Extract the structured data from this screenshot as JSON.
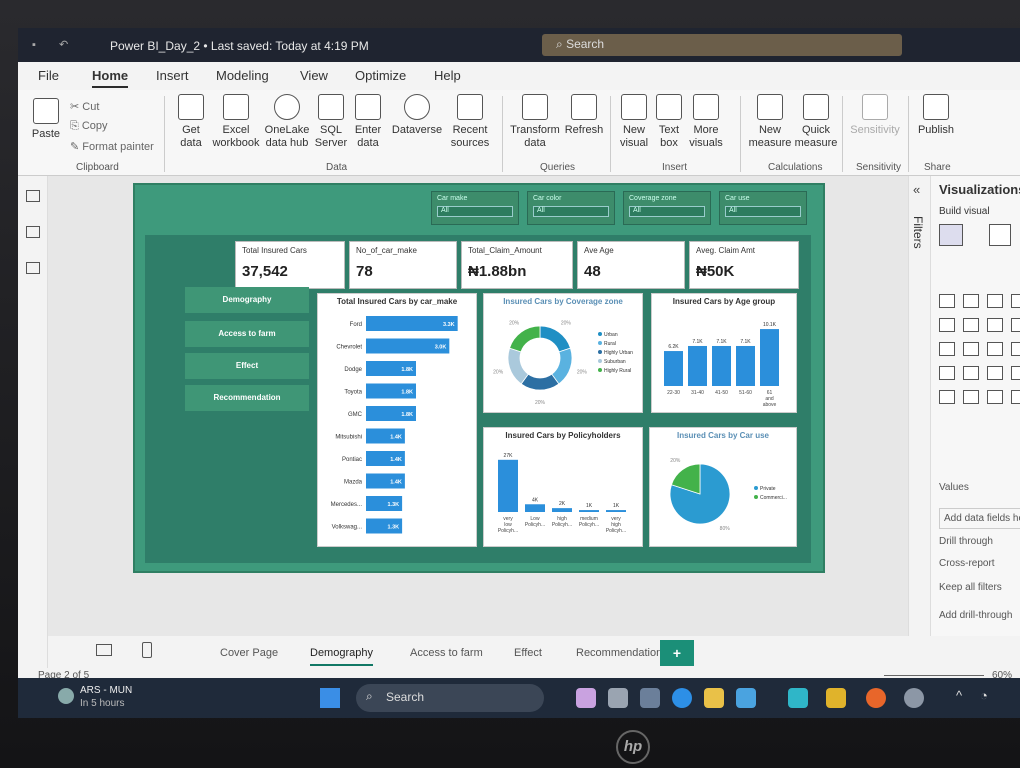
{
  "window": {
    "title": "Power BI_Day_2 • Last saved: Today at 4:19 PM",
    "search_placeholder": "Search"
  },
  "menu": [
    "File",
    "Home",
    "Insert",
    "Modeling",
    "View",
    "Optimize",
    "Help"
  ],
  "ribbon": {
    "clipboard": {
      "paste": "Paste",
      "cut": "Cut",
      "copy": "Copy",
      "format_painter": "Format painter",
      "group": "Clipboard"
    },
    "data": {
      "get_data": "Get\ndata",
      "excel": "Excel\nworkbook",
      "onelake": "OneLake\ndata hub",
      "sql": "SQL\nServer",
      "enter": "Enter\ndata",
      "dataverse": "Dataverse",
      "recent": "Recent\nsources",
      "group": "Data"
    },
    "queries": {
      "transform": "Transform\ndata",
      "refresh": "Refresh",
      "group": "Queries"
    },
    "insert": {
      "new_visual": "New\nvisual",
      "text_box": "Text\nbox",
      "more_visuals": "More\nvisuals",
      "group": "Insert"
    },
    "calculations": {
      "new_measure": "New\nmeasure",
      "quick_measure": "Quick\nmeasure",
      "group": "Calculations"
    },
    "sensitivity": {
      "label": "Sensitivity",
      "group": "Sensitivity"
    },
    "share": {
      "publish": "Publish",
      "group": "Share"
    }
  },
  "slicers": [
    {
      "label": "Car make",
      "value": "All"
    },
    {
      "label": "Car color",
      "value": "All"
    },
    {
      "label": "Coverage zone",
      "value": "All"
    },
    {
      "label": "Car use",
      "value": "All"
    }
  ],
  "kpis": [
    {
      "label": "Total Insured Cars",
      "value": "37,542"
    },
    {
      "label": "No_of_car_make",
      "value": "78"
    },
    {
      "label": "Total_Claim_Amount",
      "value": "₦1.88bn"
    },
    {
      "label": "Ave Age",
      "value": "48"
    },
    {
      "label": "Aveg. Claim Amt",
      "value": "₦50K"
    }
  ],
  "nav_buttons": [
    "Demography",
    "Access to farm",
    "Effect",
    "Recommendation"
  ],
  "charts": {
    "make": {
      "title": "Total Insured Cars by car_make",
      "chart_data": {
        "type": "bar",
        "orientation": "horizontal",
        "categories": [
          "Ford",
          "Chevrolet",
          "Dodge",
          "Toyota",
          "GMC",
          "Mitsubishi",
          "Pontiac",
          "Mazda",
          "Mercedes...",
          "Volkswag..."
        ],
        "values": [
          3.3,
          3.0,
          1.8,
          1.8,
          1.8,
          1.4,
          1.4,
          1.4,
          1.3,
          1.3
        ],
        "labels": [
          "3.3K",
          "3.0K",
          "1.8K",
          "1.8K",
          "1.8K",
          "1.4K",
          "1.4K",
          "1.4K",
          "1.3K",
          "1.3K"
        ],
        "xlim": [
          0,
          3.6
        ]
      }
    },
    "zone": {
      "title": "Insured Cars by Coverage zone",
      "chart_data": {
        "type": "pie",
        "donut": true,
        "categories": [
          "Urban",
          "Rural",
          "Highly Urban",
          "Suburban",
          "Highly Rural"
        ],
        "values": [
          20,
          20,
          20,
          20,
          20
        ],
        "labels": [
          "20%",
          "20%",
          "20%",
          "20%",
          "20%"
        ],
        "colors": [
          "#1f8fc4",
          "#5ab2e0",
          "#2c6fa3",
          "#aac9dc",
          "#43b24a"
        ]
      }
    },
    "age": {
      "title": "Insured Cars by Age group",
      "chart_data": {
        "type": "bar",
        "categories": [
          "22-30",
          "31-40",
          "41-50",
          "51-60",
          "61 and above"
        ],
        "values": [
          6.2,
          7.1,
          7.1,
          7.1,
          10.1
        ],
        "labels": [
          "6.2K",
          "7.1K",
          "7.1K",
          "7.1K",
          "10.1K"
        ],
        "ylim": [
          0,
          11
        ]
      }
    },
    "policy": {
      "title": "Insured Cars by Policyholders",
      "chart_data": {
        "type": "bar",
        "categories": [
          "very low Policyh...",
          "Low Policyh...",
          "high Policyh...",
          "medium Policyh...",
          "very high Policyh..."
        ],
        "values": [
          27,
          4,
          2,
          1,
          1
        ],
        "labels": [
          "27K",
          "4K",
          "2K",
          "1K",
          "1K"
        ],
        "ylim": [
          0,
          30
        ]
      }
    },
    "use": {
      "title": "Insured Cars by Car use",
      "chart_data": {
        "type": "pie",
        "categories": [
          "Private",
          "Commerci..."
        ],
        "values": [
          80,
          20
        ],
        "labels": [
          "80%",
          "20%"
        ],
        "colors": [
          "#2b9bd1",
          "#43b24a"
        ]
      }
    }
  },
  "panes": {
    "filters": "Filters",
    "visualizations": "Visualizations",
    "build_visual": "Build visual",
    "values": "Values",
    "add_data_fields": "Add data fields he",
    "drill_through": "Drill through",
    "cross_report": "Cross-report",
    "keep_all_filters": "Keep all filters",
    "add_drill_through": "Add drill-through"
  },
  "page_tabs": [
    "Cover Page",
    "Demography",
    "Access to farm",
    "Effect",
    "Recommendation"
  ],
  "active_tab": "Demography",
  "status": {
    "page": "Page 2 of 5",
    "zoom": "60%"
  },
  "taskbar": {
    "weather_title": "ARS - MUN",
    "weather_sub": "In 5 hours",
    "search": "Search"
  },
  "colors": {
    "accent": "#117865",
    "bar": "#2b8fdb",
    "canvas": "#3e9a7c"
  }
}
